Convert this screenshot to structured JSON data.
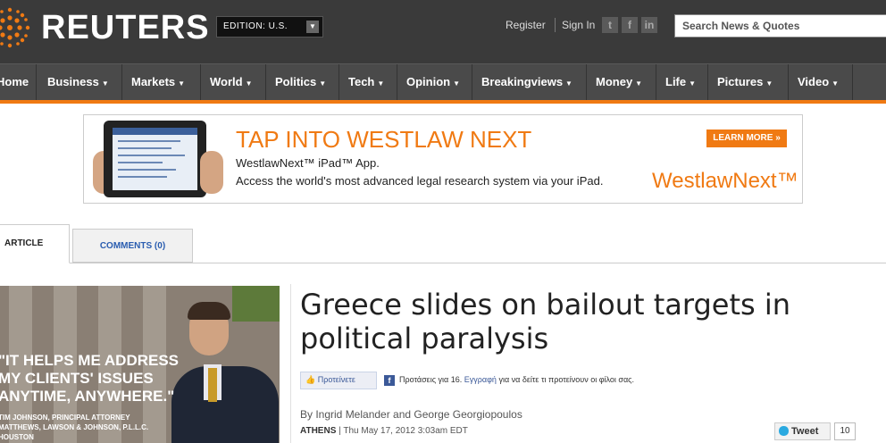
{
  "header": {
    "brand": "REUTERS",
    "edition_label": "EDITION: U.S.",
    "register": "Register",
    "sign_in": "Sign In",
    "social": [
      "t",
      "f",
      "in"
    ],
    "search_placeholder": "Search News & Quotes"
  },
  "nav": {
    "items": [
      "Home",
      "Business",
      "Markets",
      "World",
      "Politics",
      "Tech",
      "Opinion",
      "Breakingviews",
      "Money",
      "Life",
      "Pictures",
      "Video"
    ],
    "accent_color": "#f07a13"
  },
  "ad": {
    "headline": "TAP INTO WESTLAW NEXT",
    "line1": "WestlawNext™ iPad™ App.",
    "line2": "Access the world's most advanced legal research system via your iPad.",
    "cta": "LEARN MORE »",
    "brand": "WestlawNext™"
  },
  "tabs": {
    "article": "ARTICLE",
    "comments": "COMMENTS (0)"
  },
  "side_ad": {
    "quote_lines": [
      "\"IT HELPS ME ADDRESS",
      "MY CLIENTS' ISSUES",
      "ANYTIME, ANYWHERE.\""
    ],
    "attrib_lines": [
      "TIM JOHNSON, PRINCIPAL ATTORNEY",
      "MATTHEWS, LAWSON & JOHNSON, P.L.L.C.",
      "HOUSTON"
    ]
  },
  "article": {
    "headline": "Greece slides on bailout targets in political paralysis",
    "fb_like": "Προτείνετε",
    "fb_text_prefix": "Προτάσεις για 16.",
    "fb_link": "Εγγραφή",
    "fb_text_suffix": "για να δείτε τι προτείνουν οι φίλοι σας.",
    "byline": "By Ingrid Melander and George Georgiopoulos",
    "location": "ATHENS",
    "date": "| Thu May 17, 2012 3:03am EDT",
    "tweet_label": "Tweet",
    "tweet_count": "10"
  }
}
